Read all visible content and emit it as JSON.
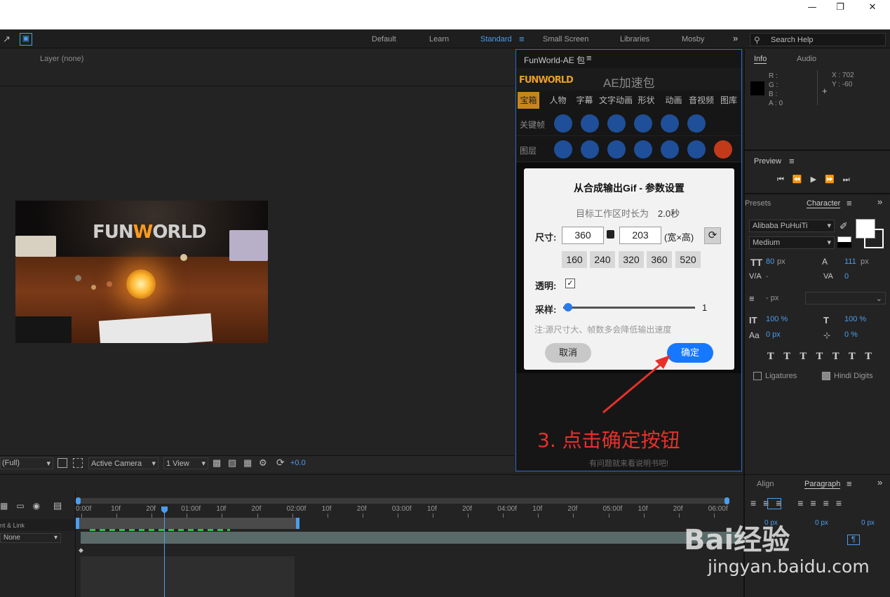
{
  "window": {
    "minimize_icon": "minimize-icon",
    "maximize_icon": "restore-icon",
    "close_icon": "close-icon"
  },
  "workspaces": [
    "Default",
    "Learn",
    "Standard",
    "Small Screen",
    "Libraries",
    "Mosby"
  ],
  "search": {
    "placeholder": "Search Help"
  },
  "comp": {
    "layer_label": "Layer (none)",
    "resolution": "(Full)",
    "camera": "Active Camera",
    "views": "1 View",
    "exposure": "+0.0"
  },
  "plugin": {
    "title": "FunWorld-AE 包",
    "logo": "FUNWORLD",
    "heading": "AE加速包",
    "tabs": [
      "宝箱",
      "人物",
      "字幕",
      "文字动画",
      "形状",
      "动画",
      "音视频",
      "图库"
    ],
    "rows": [
      "关键帧",
      "图层"
    ],
    "footer": "有问题就来看说明书吧!"
  },
  "dialog": {
    "title": "从合成输出Gif - 参数设置",
    "duration_label": "目标工作区时长为",
    "duration_value": "2.0秒",
    "size_label": "尺寸:",
    "width": "360",
    "height": "203",
    "size_unit": "(宽×高)",
    "presets": [
      "160",
      "240",
      "320",
      "360",
      "520"
    ],
    "transparent_label": "透明:",
    "sample_label": "采样:",
    "sample_value": "1",
    "note": "注:源尺寸大、帧数多会降低输出速度",
    "cancel": "取消",
    "ok": "确定"
  },
  "annotation": "3. 点击确定按钮",
  "info": {
    "tab_info": "Info",
    "tab_audio": "Audio",
    "r": "R :",
    "g": "G :",
    "b": "B :",
    "a": "A : 0",
    "x": "X : 702",
    "y": "Y : -60"
  },
  "preview": {
    "title": "Preview"
  },
  "character": {
    "tab_presets": "Presets",
    "tab_character": "Character",
    "font": "Alibaba PuHuiTi",
    "style": "Medium",
    "size": "80",
    "size_unit": "px",
    "leading": "111",
    "leading_unit": "px",
    "tracking": "0",
    "kerning": "-",
    "stroke": "- px",
    "vscale": "100 %",
    "hscale": "100 %",
    "baseline": "0 px",
    "tsume": "0 %",
    "ligatures": "Ligatures",
    "hindi": "Hindi Digits"
  },
  "timeline": {
    "ticks": [
      "0:00f",
      "10f",
      "20f",
      "01:00f",
      "10f",
      "20f",
      "02:00f",
      "10f",
      "20f",
      "03:00f",
      "10f",
      "20f",
      "04:00f",
      "10f",
      "20f",
      "05:00f",
      "10f",
      "20f",
      "06:00f"
    ],
    "parent_label": "nt & Link",
    "parent_value": "None"
  },
  "paragraph": {
    "tab_align": "Align",
    "tab_paragraph": "Paragraph",
    "indent1": "0 px",
    "indent2": "0 px",
    "indent3": "0 px"
  },
  "watermark": {
    "logo": "Bai经验",
    "url": "jingyan.baidu.com"
  },
  "colors": {
    "accent": "#4b9ded",
    "plugin_border": "#2a6ad6",
    "ok_button": "#1677ff",
    "annotation": "#e8302a"
  }
}
